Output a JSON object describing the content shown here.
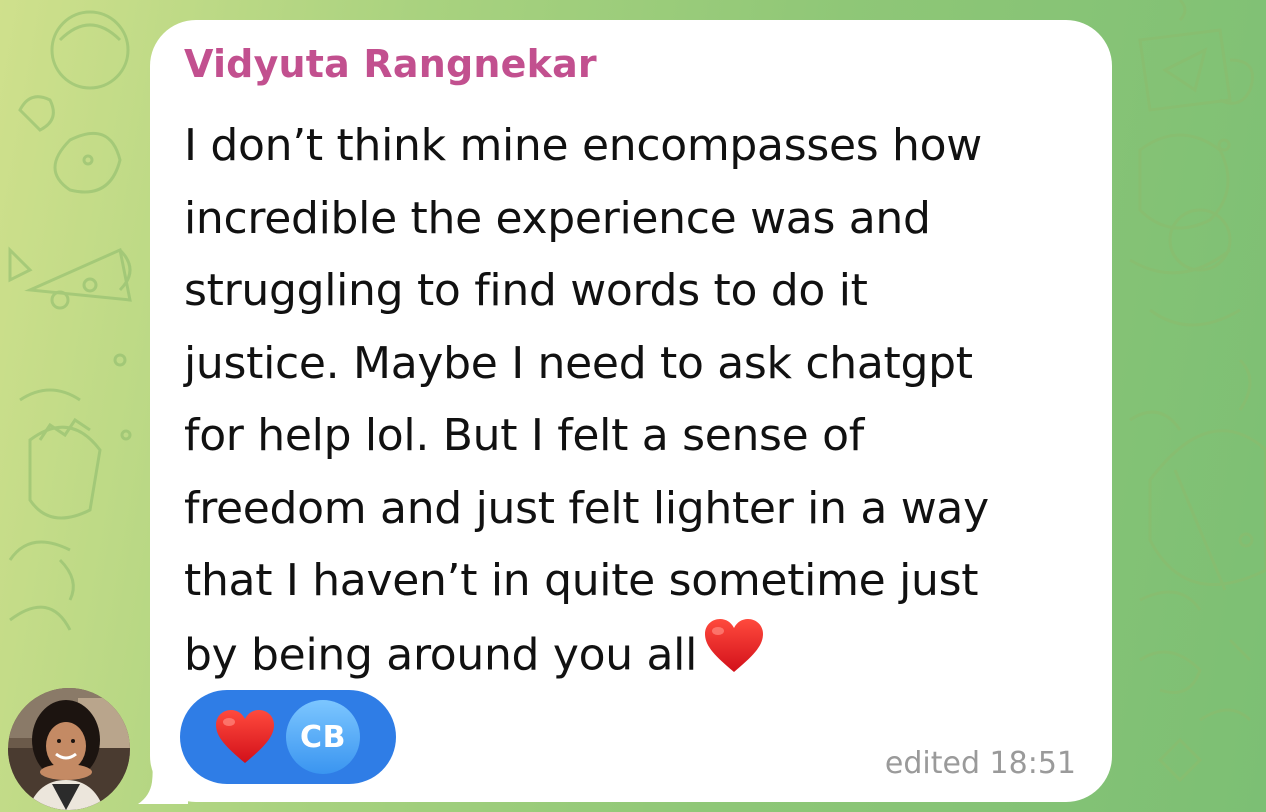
{
  "chat": {
    "background": {
      "gradient_from": "#cfe08c",
      "gradient_to": "#7cbf74",
      "doodle_color": "#8fbf6a"
    },
    "message": {
      "sender_name": "Vidyuta Rangnekar",
      "sender_color": "#c2508f",
      "text": "I don’t think mine encompasses how\nincredible the experience was and\nstruggling to find words to do it\njustice. Maybe I need to ask chatgpt\nfor help lol. But I felt a sense of\nfreedom and just felt lighter in a way\nthat I haven’t in quite sometime just\nby being around you all",
      "trailing_emoji": "red-heart-emoji",
      "meta": "edited 18:51",
      "reactions": [
        {
          "emoji": "red-heart-emoji",
          "reactor_initials": "CB",
          "pill_color": "#2f7de6"
        }
      ],
      "avatar": "sender-avatar-photo"
    }
  }
}
